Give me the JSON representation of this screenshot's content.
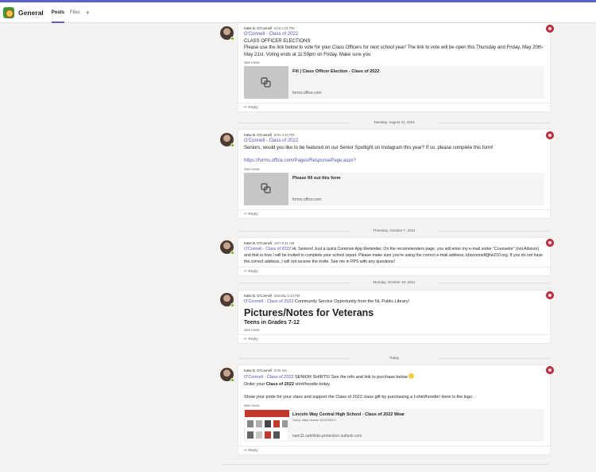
{
  "header": {
    "channel": "General",
    "tabs": [
      {
        "label": "Posts"
      },
      {
        "label": "Files"
      }
    ],
    "add_tab": "+"
  },
  "posts": [
    {
      "author": "Katie B. O'Connell",
      "time": "5/16 1:01 PM",
      "mention": "O'Connell - Class of 2022",
      "lines": [
        "CLASS OFFICER ELECTIONS",
        "Please use the link below to vote for your Class Officers for next school year! The link to vote will be open this Thursday and Friday, May 20th-May 21st. Voting ends at 11:59pm on Friday. Make sure you"
      ],
      "see_more": "See more",
      "card": {
        "title": "Fill | Class Officer Election - Class of 2022",
        "domain": "forms.office.com"
      },
      "reply": "Reply"
    },
    {
      "author": "Katie B. O'Connell",
      "time": "8/31 3:10 PM",
      "mention": "O'Connell - Class of 2022",
      "lines": [
        "Seniors, would you like to be featured on our Senior Spotlight on Instagram this year? If so, please complete this form!"
      ],
      "link": "https://forms.office.com/Pages/ResponsePage.aspx?",
      "see_more": "See more",
      "card": {
        "title": "Please fill out this form",
        "domain": "forms.office.com"
      },
      "reply": "Reply"
    },
    {
      "author": "Katie B. O'Connell",
      "time": "10/7 8:41 AM",
      "mention": "O'Connell - Class of 2022",
      "text": " Hi, Seniors! Just a quick Common App Reminder. On the recommenders page, you will enter my e-mail under \"Counselor\" (not Advisor) and that is how I will be invited to complete your school report. Please make sure you're using the correct e-mail address: kboconnell@lw210.org. If you do not have the correct address, I will not receive the invite. See me in PPS with any questions!",
      "reply": "Reply"
    },
    {
      "author": "Katie B. O'Connell",
      "time": "Monday 1:43 PM",
      "mention": "O'Connell - Class of 2022",
      "text": " Community Service Opportunity from the NL Public Library!",
      "heading": "Pictures/Notes for Veterans",
      "subheading": "Teens in Grades 7-12",
      "see_more": "See more",
      "reply": "Reply"
    },
    {
      "author": "Katie B. O'Connell",
      "time": "8:06 AM",
      "mention": "O'Connell - Class of 2022",
      "text": " SENIOR SHIRTS! See the info and link to purchase below",
      "order_pre": "Order your ",
      "order_bold": "Class of 2022",
      "order_post": " shirt/hoodie today.",
      "pride": "Show your pride for your class and support the Class of 2022 class gift by purchasing a t-shirt/hoodie! Here is the logo.",
      "see_more": "See more",
      "card": {
        "title": "Lincoln Way Central High School - Class of 2022 Wear",
        "sub": "Hurry, shop closes 11/01/2021!",
        "domain": "nam11.safelinks.protection.outlook.com"
      },
      "reply": "Reply"
    }
  ],
  "dividers": [
    "Tuesday, August 31, 2021",
    "Thursday, October 7, 2021",
    "Monday, October 18, 2021",
    "Today"
  ],
  "colors": {
    "accent": "#5b5fc7",
    "mention": "#4f52b2",
    "presence": "#6bb700",
    "reaction": "#c4314b"
  }
}
